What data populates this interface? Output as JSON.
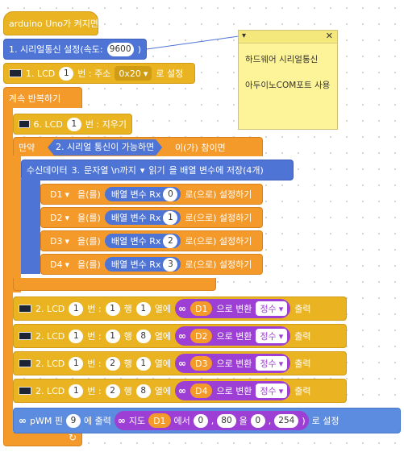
{
  "hat": {
    "label": "arduino Uno가 켜지면"
  },
  "serial": {
    "label": "1. 시리얼통신 설정(속도:",
    "speed": "9600",
    "close": ")"
  },
  "lcd_init": {
    "label": "1. LCD",
    "num": "1",
    "addr_label": "번 : 주소",
    "addr": "0x20",
    "suffix": "로 설정"
  },
  "loop": {
    "label": "계속 반복하기"
  },
  "lcd_clear": {
    "label": "6. LCD",
    "num": "1",
    "suffix": "번 : 지우기"
  },
  "if_block": {
    "label": "만약",
    "cond": "2. 시리얼 통신이 가능하면",
    "suffix": "이(가) 참이면"
  },
  "receive": {
    "label": "수신데이터",
    "num": "3.",
    "mid": "문자열 \\n까지",
    "read": "읽기",
    "suffix": "을 배열 변수에 저장(4개)"
  },
  "assigns": [
    {
      "var": "D1",
      "mid": "을(를)",
      "arr": "배열 변수 Rx",
      "idx": "0",
      "suffix": "로(으로) 설정하기"
    },
    {
      "var": "D2",
      "mid": "을(를)",
      "arr": "배열 변수 Rx",
      "idx": "1",
      "suffix": "로(으로) 설정하기"
    },
    {
      "var": "D3",
      "mid": "을(를)",
      "arr": "배열 변수 Rx",
      "idx": "2",
      "suffix": "로(으로) 설정하기"
    },
    {
      "var": "D4",
      "mid": "을(를)",
      "arr": "배열 변수 Rx",
      "idx": "3",
      "suffix": "로(으로) 설정하기"
    }
  ],
  "lcd_prints": [
    {
      "label": "2. LCD",
      "num": "1",
      "row_label": "번 :",
      "row": "1",
      "col_label": "행",
      "col": "1",
      "col_suffix": "열에",
      "var": "D1",
      "conv": "으로 변환",
      "type": "정수",
      "out": "출력"
    },
    {
      "label": "2. LCD",
      "num": "1",
      "row_label": "번 :",
      "row": "1",
      "col_label": "행",
      "col": "8",
      "col_suffix": "열에",
      "var": "D2",
      "conv": "으로 변환",
      "type": "정수",
      "out": "출력"
    },
    {
      "label": "2. LCD",
      "num": "1",
      "row_label": "번 :",
      "row": "2",
      "col_label": "행",
      "col": "1",
      "col_suffix": "열에",
      "var": "D3",
      "conv": "으로 변환",
      "type": "정수",
      "out": "출력"
    },
    {
      "label": "2. LCD",
      "num": "1",
      "row_label": "번 :",
      "row": "2",
      "col_label": "행",
      "col": "8",
      "col_suffix": "열에",
      "var": "D4",
      "conv": "으로 변환",
      "type": "정수",
      "out": "출력"
    }
  ],
  "pwm": {
    "label": "pWM 핀",
    "pin": "9",
    "mid": "에 출력",
    "map": "지도",
    "var": "D1",
    "from_label": "에서",
    "a": "0",
    "b": "80",
    "to_label": "을",
    "c": "0",
    "d": "254",
    "close": ")",
    "suffix": "로 설정"
  },
  "comment": {
    "line1": "하드웨어 시리얼통신",
    "line2": "아두이노COM포트 사용",
    "close": "✕"
  },
  "colors": {
    "yellow": "#e9b321",
    "orange": "#f39a2b",
    "blue": "#4e74d6",
    "purple": "#9d3fd4",
    "note": "#fdf49a"
  }
}
